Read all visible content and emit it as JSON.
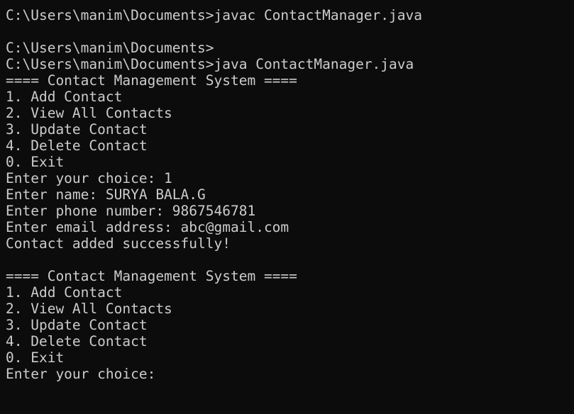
{
  "terminal": {
    "lines": [
      "C:\\Users\\manim\\Documents>javac ContactManager.java",
      "",
      "C:\\Users\\manim\\Documents>",
      "C:\\Users\\manim\\Documents>java ContactManager.java",
      "==== Contact Management System ====",
      "1. Add Contact",
      "2. View All Contacts",
      "3. Update Contact",
      "4. Delete Contact",
      "0. Exit",
      "Enter your choice: 1",
      "Enter name: SURYA BALA.G",
      "Enter phone number: 9867546781",
      "Enter email address: abc@gmail.com",
      "Contact added successfully!",
      "",
      "==== Contact Management System ====",
      "1. Add Contact",
      "2. View All Contacts",
      "3. Update Contact",
      "4. Delete Contact",
      "0. Exit",
      "Enter your choice: "
    ]
  },
  "colors": {
    "background": "#0c0c0c",
    "text": "#cccccc"
  }
}
